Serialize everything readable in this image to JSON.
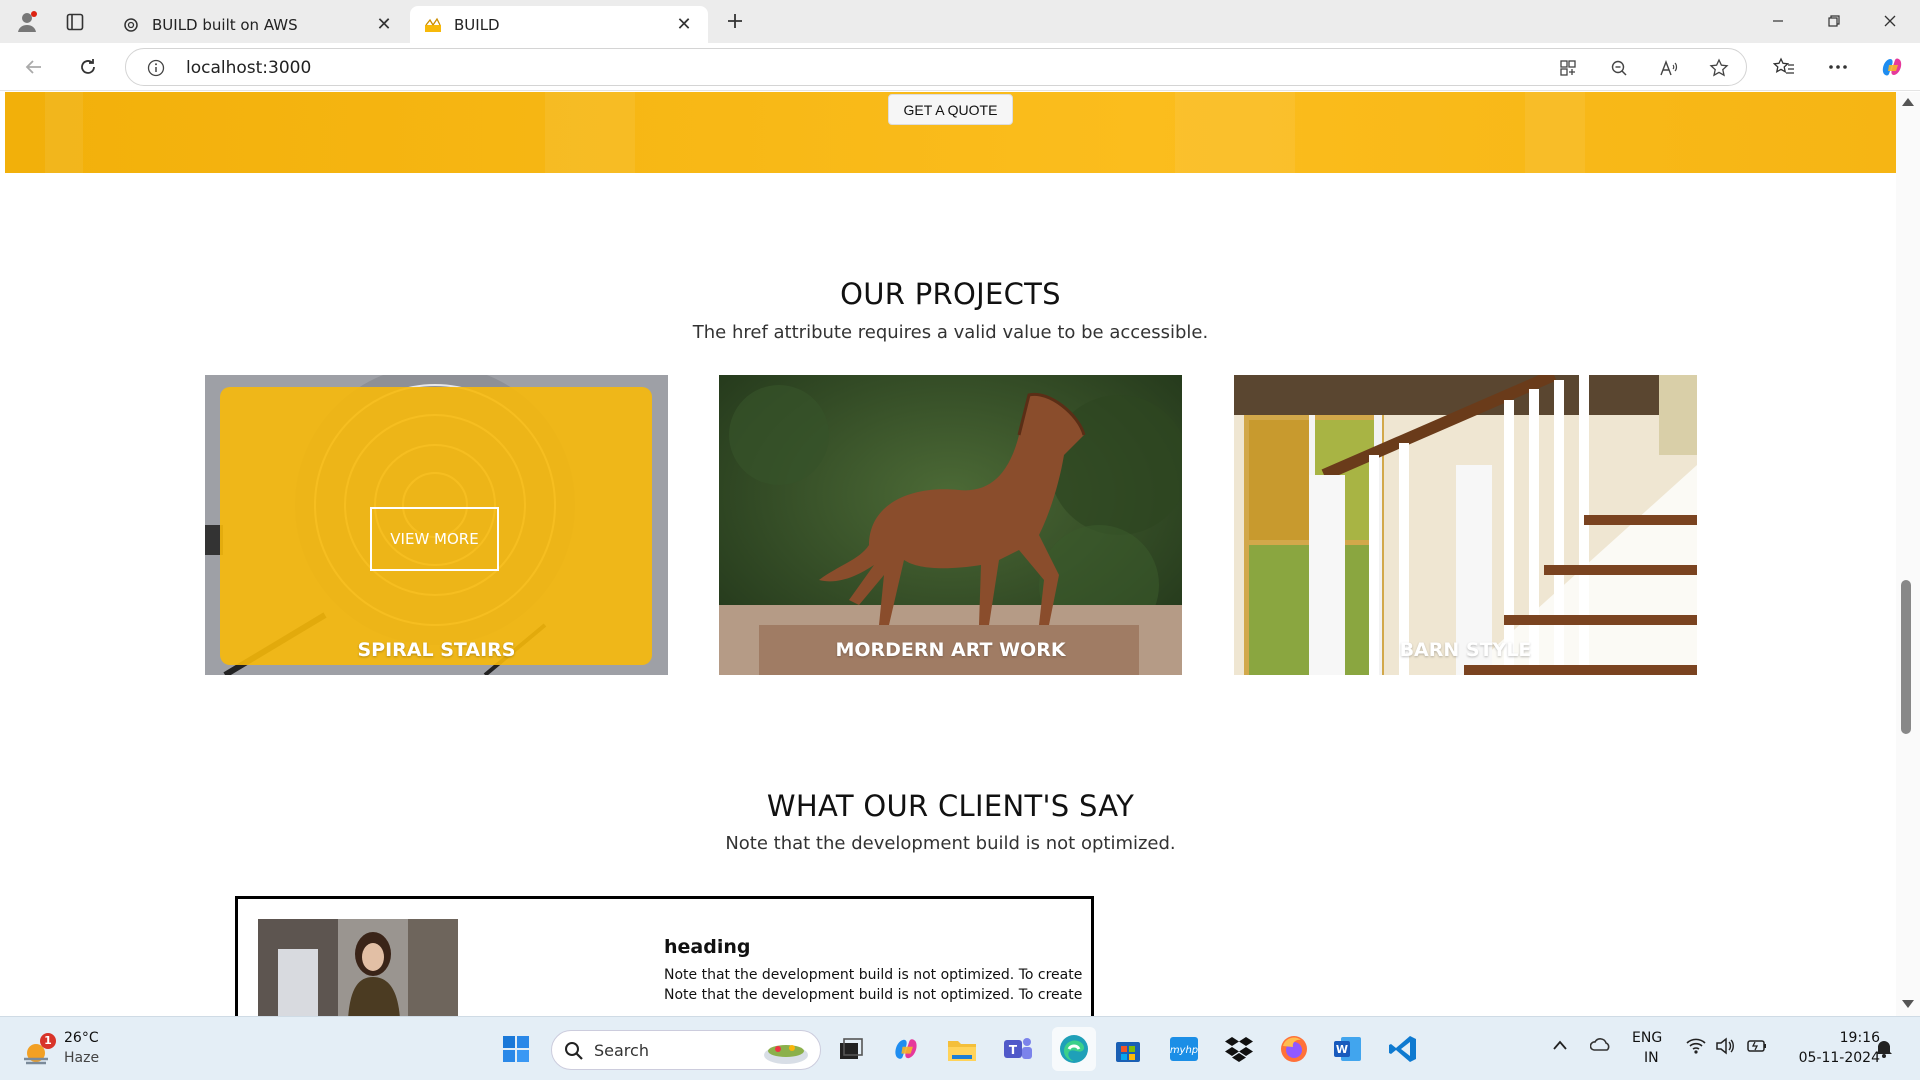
{
  "browser": {
    "tabs": [
      {
        "title": "BUILD built on AWS"
      },
      {
        "title": "BUILD"
      }
    ],
    "url": "localhost:3000"
  },
  "hero": {
    "quote_button": "GET A QUOTE"
  },
  "projects": {
    "title": "OUR PROJECTS",
    "subtitle": "The href attribute requires a valid value to be accessible.",
    "view_more": "VIEW MORE",
    "items": [
      {
        "label": "SPIRAL STAIRS"
      },
      {
        "label": "MORDERN ART WORK"
      },
      {
        "label": "BARN STYLE"
      }
    ]
  },
  "testimonials": {
    "title": "WHAT OUR CLIENT'S SAY",
    "subtitle": "Note that the development build is not optimized.",
    "card": {
      "heading": "heading",
      "lines": [
        "Note that the development build is not optimized. To create",
        "Note that the development build is not optimized. To create"
      ]
    }
  },
  "taskbar": {
    "weather_temp": "26°C",
    "weather_desc": "Haze",
    "weather_badge": "1",
    "search_placeholder": "Search",
    "lang_top": "ENG",
    "lang_bottom": "IN",
    "time": "19:16",
    "date": "05-11-2024"
  },
  "colors": {
    "accent": "#f7b90a",
    "tab_bar": "#ececec",
    "taskbar": "#e4eef6"
  }
}
